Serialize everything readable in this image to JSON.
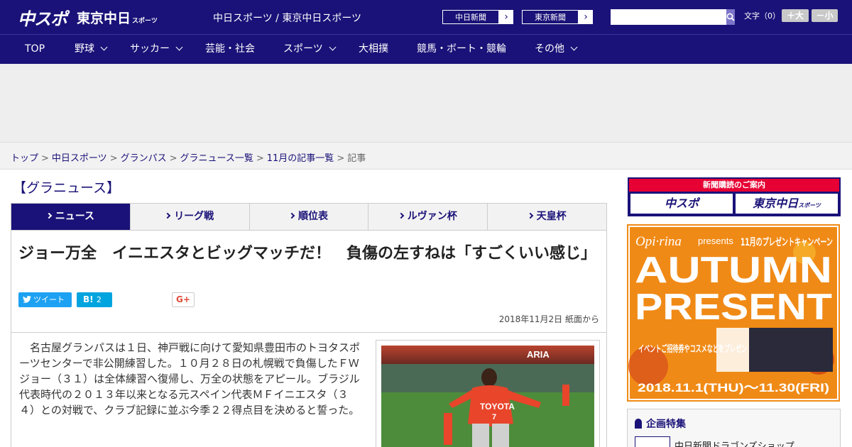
{
  "header": {
    "logo_main": "中スポ",
    "logo_tokyo": "東京中日",
    "logo_tokyo_small": "スポーツ",
    "site_title": "中日スポーツ / 東京中日スポーツ",
    "paper_buttons": [
      "中日新聞",
      "東京新聞"
    ],
    "search_placeholder": "",
    "font_size_label": "文字（0）",
    "font_larger": "＋大",
    "font_smaller": "－小"
  },
  "nav": {
    "items": [
      {
        "label": "TOP",
        "dropdown": false
      },
      {
        "label": "野球",
        "dropdown": true
      },
      {
        "label": "サッカー",
        "dropdown": true
      },
      {
        "label": "芸能・社会",
        "dropdown": false
      },
      {
        "label": "スポーツ",
        "dropdown": true
      },
      {
        "label": "大相撲",
        "dropdown": false
      },
      {
        "label": "競馬・ボート・競輪",
        "dropdown": false
      },
      {
        "label": "その他",
        "dropdown": true
      }
    ]
  },
  "breadcrumb": {
    "links": [
      "トップ",
      "中日スポーツ",
      "グランパス",
      "グラニュース一覧",
      "11月の記事一覧"
    ],
    "current": "記事",
    "separator": ">"
  },
  "section": {
    "title": "【グラニュース】",
    "tabs": [
      "ニュース",
      "リーグ戦",
      "順位表",
      "ルヴァン杯",
      "天皇杯"
    ],
    "active_tab": 0
  },
  "article": {
    "headline": "ジョー万全　イニエスタとビッグマッチだ！　負傷の左すねは「すごくいい感じ」",
    "tweet_label": "ツイート",
    "hatena_label": "B!",
    "hatena_count": "2",
    "gplus_label": "G+",
    "date": "2018年11月2日 紙面から",
    "body": "　名古屋グランパスは１日、神戸戦に向けて愛知県豊田市のトヨタスポーツセンターで非公開練習した。１０月２８日の札幌戦で負傷したＦＷジョー（３１）は全体練習へ復帰し、万全の状態をアピール。ブラジル代表時代の２０１３年以来となる元スペイン代表ＭＦイニエスタ（３４）との対戦で、クラブ記録に並ぶ今季２２得点目を決めると誓った。",
    "photo_texts": [
      "TOYOTA",
      "7",
      "ARIA"
    ]
  },
  "sidebar": {
    "subscribe_head": "新聞購読のご案内",
    "subscribe_buttons": [
      "中スポ",
      "東京中日"
    ],
    "subscribe_small": "スポーツ",
    "banner": {
      "brand": "Opi·rina",
      "presents": "presents",
      "campaign": "11月のプレゼントキャンペーン",
      "line1": "AUTUMN",
      "line2": "PRESENT",
      "event": "イベントご招待券やコスメなどをプレゼント!",
      "dates": "2018.11.1(THU)～11.30(FRI)"
    },
    "feature_title": "企画特集",
    "feature_item": "中日新聞ドラゴンズショップ"
  },
  "colors": {
    "brand_navy": "#1a1278",
    "accent_red": "#e60033",
    "twitter": "#1da1f2",
    "hatena": "#00a4de",
    "banner_orange": "#f08a16"
  }
}
